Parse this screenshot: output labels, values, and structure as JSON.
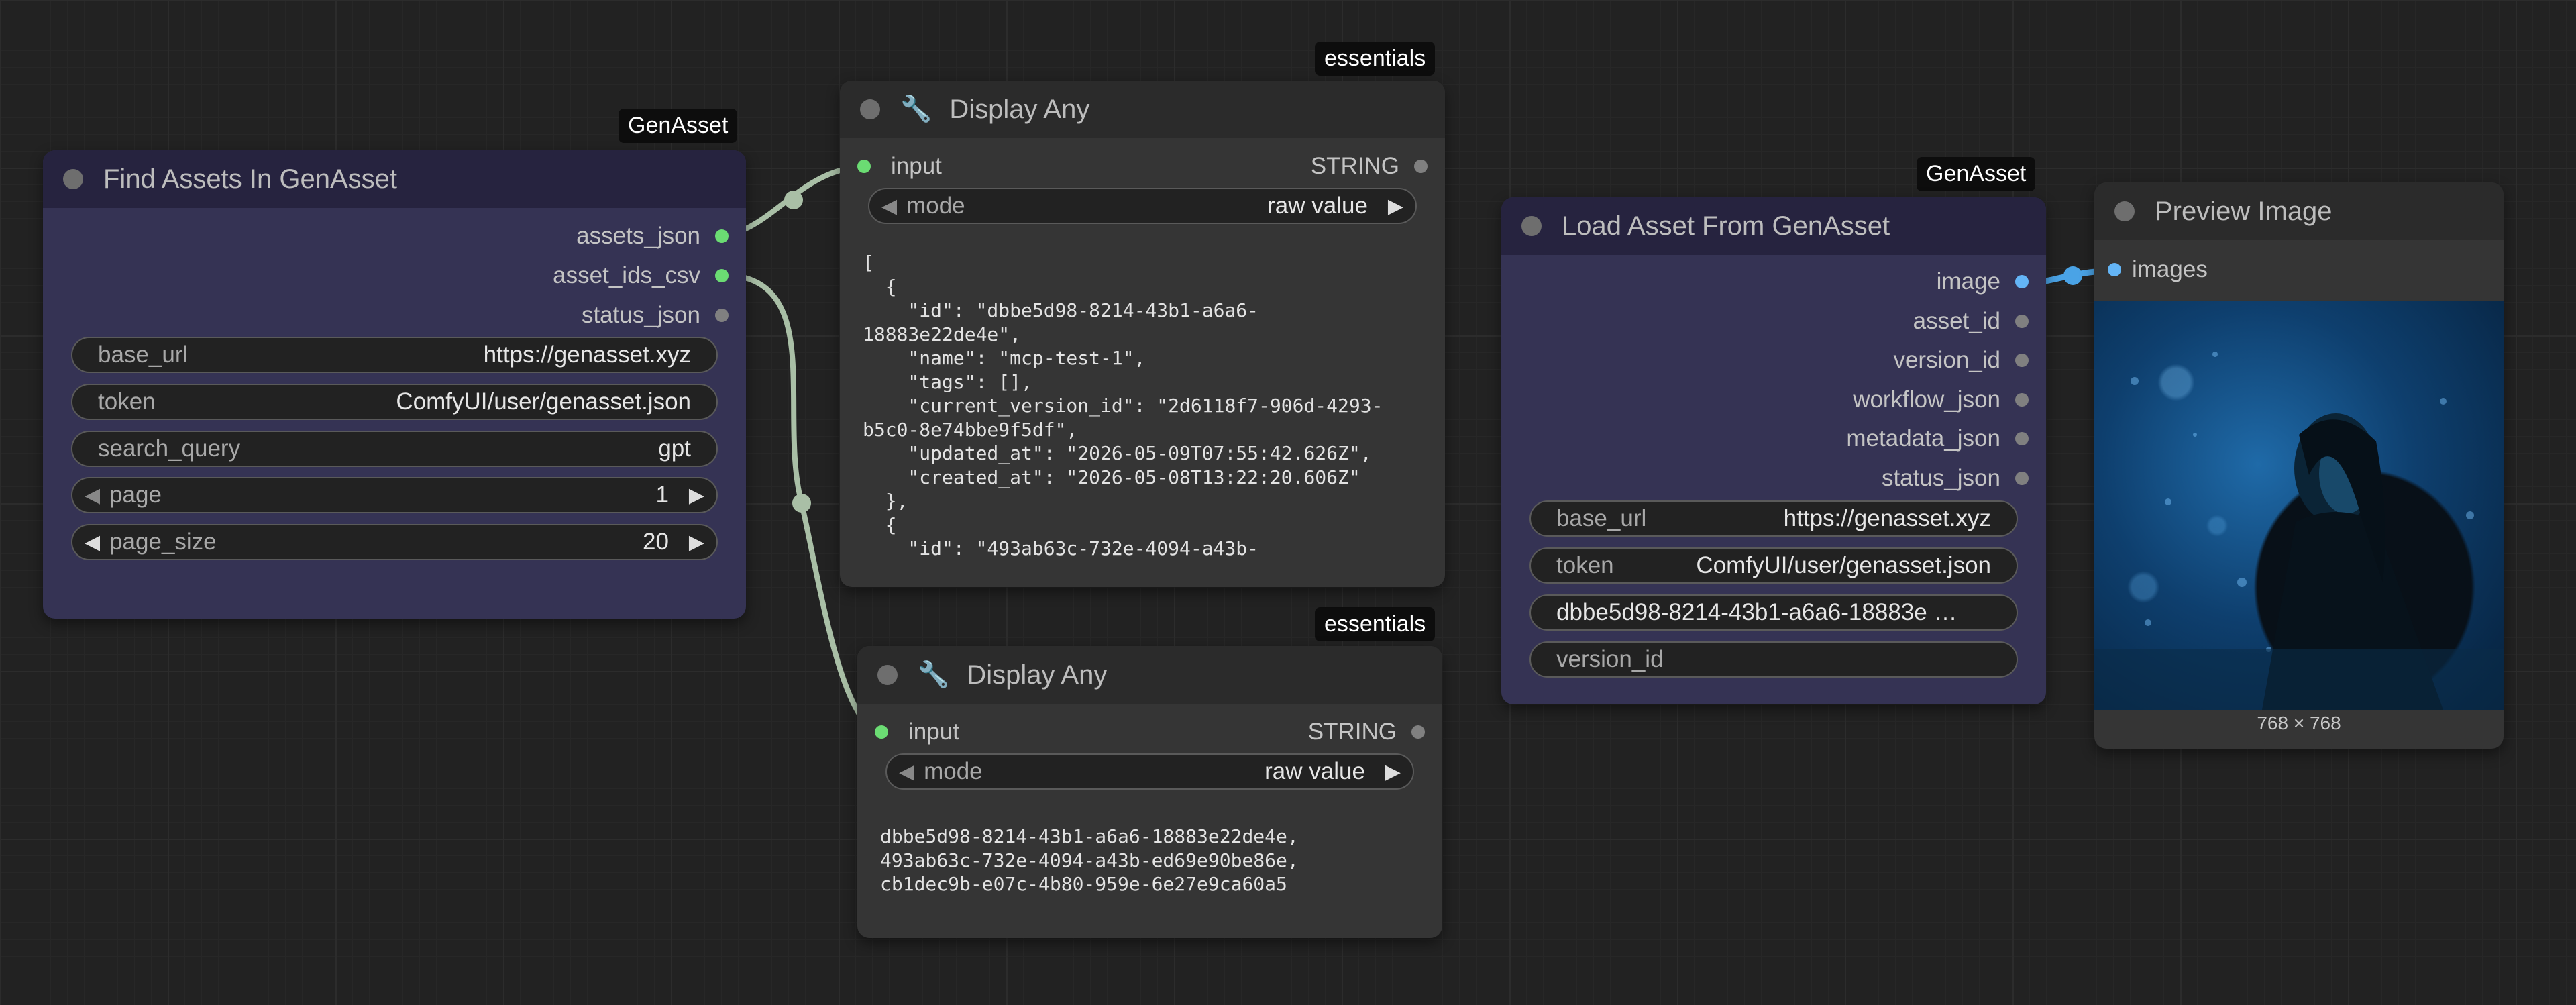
{
  "badges": {
    "find": "GenAsset",
    "display1": "essentials",
    "display2": "essentials",
    "load": "GenAsset"
  },
  "find_node": {
    "title": "Find Assets In GenAsset",
    "outputs": [
      "assets_json",
      "asset_ids_csv",
      "status_json"
    ],
    "widgets": [
      {
        "label": "base_url",
        "value": "https://genasset.xyz"
      },
      {
        "label": "token",
        "value": "ComfyUI/user/genasset.json"
      },
      {
        "label": "search_query",
        "value": "gpt"
      },
      {
        "label": "page",
        "value": "1"
      },
      {
        "label": "page_size",
        "value": "20"
      }
    ]
  },
  "display1": {
    "title": "Display Any",
    "input": "input",
    "output": "STRING",
    "mode_label": "mode",
    "mode_value": "raw value",
    "text": "[\n  {\n    \"id\": \"dbbe5d98-8214-43b1-a6a6-\n18883e22de4e\",\n    \"name\": \"mcp-test-1\",\n    \"tags\": [],\n    \"current_version_id\": \"2d6118f7-906d-4293-\nb5c0-8e74bbe9f5df\",\n    \"updated_at\": \"2026-05-09T07:55:42.626Z\",\n    \"created_at\": \"2026-05-08T13:22:20.606Z\"\n  },\n  {\n    \"id\": \"493ab63c-732e-4094-a43b-"
  },
  "display2": {
    "title": "Display Any",
    "input": "input",
    "output": "STRING",
    "mode_label": "mode",
    "mode_value": "raw value",
    "text": "dbbe5d98-8214-43b1-a6a6-18883e22de4e,\n493ab63c-732e-4094-a43b-ed69e90be86e,\ncb1dec9b-e07c-4b80-959e-6e27e9ca60a5"
  },
  "load_node": {
    "title": "Load Asset From GenAsset",
    "outputs": [
      "image",
      "asset_id",
      "version_id",
      "workflow_json",
      "metadata_json",
      "status_json"
    ],
    "widgets": [
      {
        "label": "base_url",
        "value": "https://genasset.xyz"
      },
      {
        "label": "token",
        "value": "ComfyUI/user/genasset.json"
      },
      {
        "label": "",
        "value": "dbbe5d98-8214-43b1-a6a6-18883e  …"
      },
      {
        "label": "version_id",
        "value": ""
      }
    ]
  },
  "preview_node": {
    "title": "Preview Image",
    "input": "images",
    "image_size": "768 × 768"
  },
  "colors": {
    "canvas": "#222222",
    "purple_body": "#353354",
    "purple_title": "#26233f",
    "gray_body": "#353535",
    "link_green": "#a9bfa6",
    "link_blue": "#4aa3e6",
    "slot_green": "#6bdc73",
    "slot_blue": "#64b5f6"
  }
}
